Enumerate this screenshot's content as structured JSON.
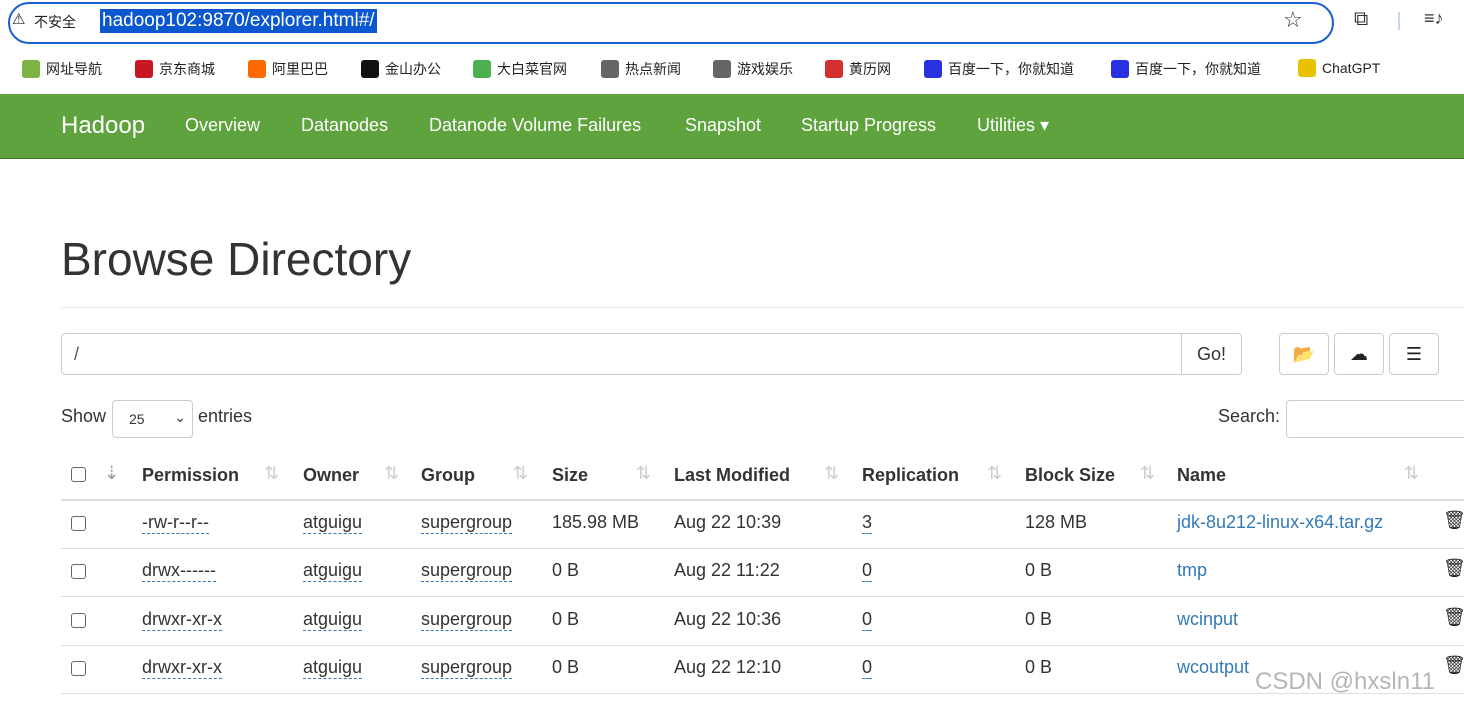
{
  "browser": {
    "warning": "不安全",
    "url": "hadoop102:9870/explorer.html#/",
    "bookmarks": [
      {
        "label": "网址导航",
        "color": "#7cb342"
      },
      {
        "label": "京东商城",
        "color": "#c81623"
      },
      {
        "label": "阿里巴巴",
        "color": "#ff6a00"
      },
      {
        "label": "金山办公",
        "color": "#111111"
      },
      {
        "label": "大白菜官网",
        "color": "#4caf50"
      },
      {
        "label": "热点新闻",
        "color": "#666666"
      },
      {
        "label": "游戏娱乐",
        "color": "#666666"
      },
      {
        "label": "黄历网",
        "color": "#d32f2f"
      },
      {
        "label": "百度一下，你就知道",
        "color": "#2932e1"
      },
      {
        "label": "百度一下，你就知道",
        "color": "#2932e1"
      },
      {
        "label": "ChatGPT",
        "color": "#e6c200"
      }
    ]
  },
  "navbar": {
    "brand": "Hadoop",
    "items": [
      "Overview",
      "Datanodes",
      "Datanode Volume Failures",
      "Snapshot",
      "Startup Progress",
      "Utilities ▾"
    ],
    "color": "#5fa33e"
  },
  "page": {
    "title": "Browse Directory",
    "path": "/",
    "go": "Go!",
    "show": "Show",
    "entries_value": "25",
    "entries": "entries",
    "search": "Search:"
  },
  "table": {
    "columns": [
      "Permission",
      "Owner",
      "Group",
      "Size",
      "Last Modified",
      "Replication",
      "Block Size",
      "Name"
    ],
    "rows": [
      {
        "permission": "-rw-r--r--",
        "owner": "atguigu",
        "group": "supergroup",
        "size": "185.98 MB",
        "modified": "Aug 22 10:39",
        "replication": "3",
        "block": "128 MB",
        "name": "jdk-8u212-linux-x64.tar.gz"
      },
      {
        "permission": "drwx------",
        "owner": "atguigu",
        "group": "supergroup",
        "size": "0 B",
        "modified": "Aug 22 11:22",
        "replication": "0",
        "block": "0 B",
        "name": "tmp"
      },
      {
        "permission": "drwxr-xr-x",
        "owner": "atguigu",
        "group": "supergroup",
        "size": "0 B",
        "modified": "Aug 22 10:36",
        "replication": "0",
        "block": "0 B",
        "name": "wcinput"
      },
      {
        "permission": "drwxr-xr-x",
        "owner": "atguigu",
        "group": "supergroup",
        "size": "0 B",
        "modified": "Aug 22 12:10",
        "replication": "0",
        "block": "0 B",
        "name": "wcoutput"
      }
    ]
  },
  "watermark": "CSDN @hxsln11"
}
